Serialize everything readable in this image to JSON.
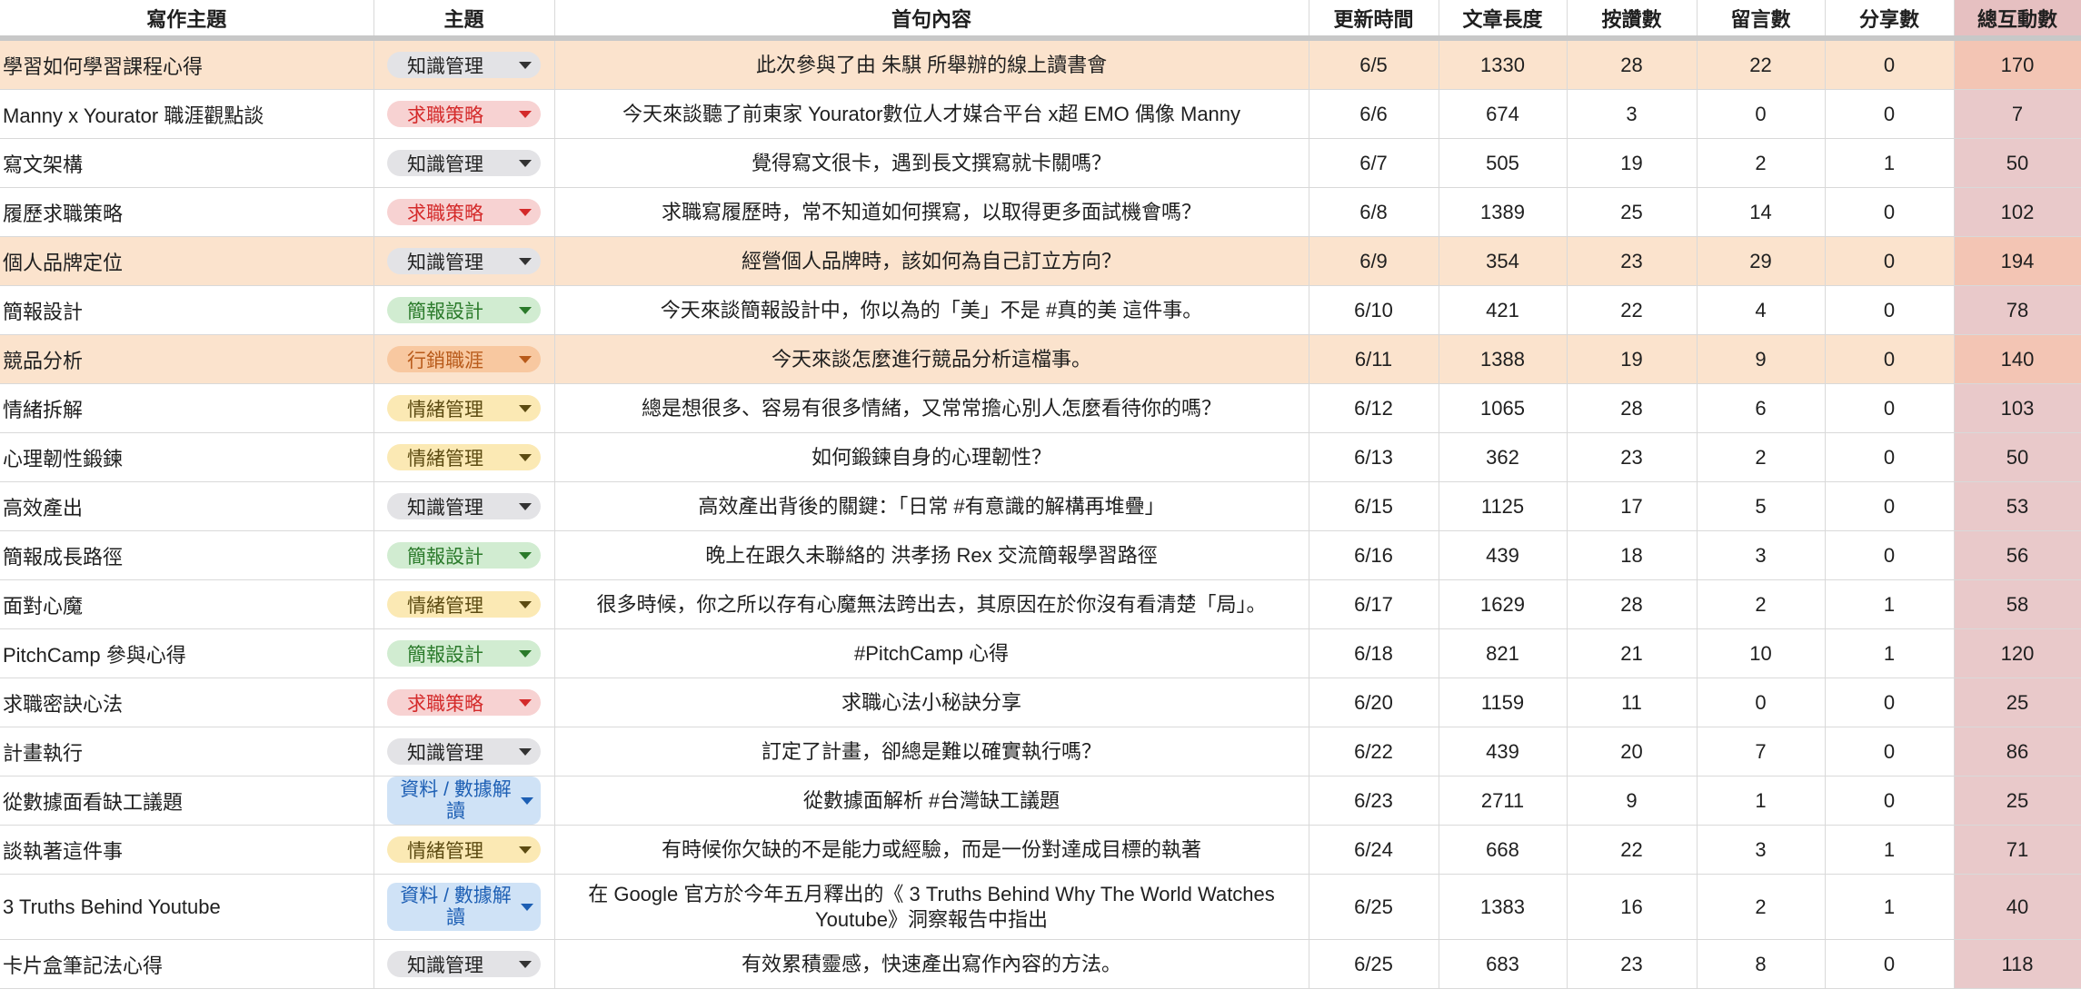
{
  "headers": {
    "topic": "寫作主題",
    "category": "主題",
    "first_sentence": "首句內容",
    "updated": "更新時間",
    "length": "文章長度",
    "likes": "按讚數",
    "comments": "留言數",
    "shares": "分享數",
    "total": "總互動數"
  },
  "colors": {
    "highlight_row": "#fbe3cd",
    "total_column": "#e9c9ca",
    "chip_gray": "#e3e3e6",
    "chip_red": "#f7d2d2",
    "chip_green": "#d1ecd1",
    "chip_yellow": "#fbe9b4",
    "chip_orange": "#f8c8a0",
    "chip_blue": "#cfe2f6"
  },
  "rows": [
    {
      "topic": "學習如何學習課程心得",
      "category": "知識管理",
      "first": "此次參與了由 朱騏 所舉辦的線上讀書會",
      "updated": "6/5",
      "length": "1330",
      "likes": "28",
      "comments": "22",
      "shares": "0",
      "total": "170"
    },
    {
      "topic": "Manny x Yourator 職涯觀點談",
      "category": "求職策略",
      "first": "今天來談聽了前東家 Yourator數位人才媒合平台 x超 EMO 偶像 Manny",
      "updated": "6/6",
      "length": "674",
      "likes": "3",
      "comments": "0",
      "shares": "0",
      "total": "7"
    },
    {
      "topic": "寫文架構",
      "category": "知識管理",
      "first": "覺得寫文很卡，遇到長文撰寫就卡關嗎？",
      "updated": "6/7",
      "length": "505",
      "likes": "19",
      "comments": "2",
      "shares": "1",
      "total": "50"
    },
    {
      "topic": "履歷求職策略",
      "category": "求職策略",
      "first": "求職寫履歷時，常不知道如何撰寫，以取得更多面試機會嗎？",
      "updated": "6/8",
      "length": "1389",
      "likes": "25",
      "comments": "14",
      "shares": "0",
      "total": "102"
    },
    {
      "topic": "個人品牌定位",
      "category": "知識管理",
      "first": "經營個人品牌時，該如何為自己訂立方向？",
      "updated": "6/9",
      "length": "354",
      "likes": "23",
      "comments": "29",
      "shares": "0",
      "total": "194"
    },
    {
      "topic": "簡報設計",
      "category": "簡報設計",
      "first": "今天來談簡報設計中，你以為的「美」不是 #真的美 這件事。",
      "updated": "6/10",
      "length": "421",
      "likes": "22",
      "comments": "4",
      "shares": "0",
      "total": "78"
    },
    {
      "topic": "競品分析",
      "category": "行銷職涯",
      "first": "今天來談怎麼進行競品分析這檔事。",
      "updated": "6/11",
      "length": "1388",
      "likes": "19",
      "comments": "9",
      "shares": "0",
      "total": "140"
    },
    {
      "topic": "情緒拆解",
      "category": "情緒管理",
      "first": "總是想很多、容易有很多情緒，又常常擔心別人怎麼看待你的嗎？",
      "updated": "6/12",
      "length": "1065",
      "likes": "28",
      "comments": "6",
      "shares": "0",
      "total": "103"
    },
    {
      "topic": "心理韌性鍛鍊",
      "category": "情緒管理",
      "first": "如何鍛鍊自身的心理韌性？",
      "updated": "6/13",
      "length": "362",
      "likes": "23",
      "comments": "2",
      "shares": "0",
      "total": "50"
    },
    {
      "topic": "高效產出",
      "category": "知識管理",
      "first": "高效產出背後的關鍵：「日常 #有意識的解構再堆疊」",
      "updated": "6/15",
      "length": "1125",
      "likes": "17",
      "comments": "5",
      "shares": "0",
      "total": "53"
    },
    {
      "topic": "簡報成長路徑",
      "category": "簡報設計",
      "first": "晚上在跟久未聯絡的 洪孝扬 Rex 交流簡報學習路徑",
      "updated": "6/16",
      "length": "439",
      "likes": "18",
      "comments": "3",
      "shares": "0",
      "total": "56"
    },
    {
      "topic": "面對心魔",
      "category": "情緒管理",
      "first": "很多時候，你之所以存有心魔無法跨出去，其原因在於你沒有看清楚「局」。",
      "updated": "6/17",
      "length": "1629",
      "likes": "28",
      "comments": "2",
      "shares": "1",
      "total": "58"
    },
    {
      "topic": "PitchCamp 參與心得",
      "category": "簡報設計",
      "first": "#PitchCamp 心得",
      "updated": "6/18",
      "length": "821",
      "likes": "21",
      "comments": "10",
      "shares": "1",
      "total": "120"
    },
    {
      "topic": "求職密訣心法",
      "category": "求職策略",
      "first": "求職心法小秘訣分享",
      "updated": "6/20",
      "length": "1159",
      "likes": "11",
      "comments": "0",
      "shares": "0",
      "total": "25"
    },
    {
      "topic": "計畫執行",
      "category": "知識管理",
      "first": "訂定了計畫，卻總是難以確實執行嗎？",
      "updated": "6/22",
      "length": "439",
      "likes": "20",
      "comments": "7",
      "shares": "0",
      "total": "86"
    },
    {
      "topic": "從數據面看缺工議題",
      "category": "資料 / 數據解讀",
      "first": "從數據面解析 #台灣缺工議題",
      "updated": "6/23",
      "length": "2711",
      "likes": "9",
      "comments": "1",
      "shares": "0",
      "total": "25"
    },
    {
      "topic": "談執著這件事",
      "category": "情緒管理",
      "first": "有時候你欠缺的不是能力或經驗，而是一份對達成目標的執著",
      "updated": "6/24",
      "length": "668",
      "likes": "22",
      "comments": "3",
      "shares": "1",
      "total": "71"
    },
    {
      "topic": "3 Truths Behind Youtube",
      "category": "資料 / 數據解讀",
      "first": "在 Google 官方於今年五月釋出的《 3 Truths Behind Why The World Watches Youtube》洞察報告中指出",
      "updated": "6/25",
      "length": "1383",
      "likes": "16",
      "comments": "2",
      "shares": "1",
      "total": "40"
    },
    {
      "topic": "卡片盒筆記法心得",
      "category": "知識管理",
      "first": "有效累積靈感，快速產出寫作內容的方法。",
      "updated": "6/25",
      "length": "683",
      "likes": "23",
      "comments": "8",
      "shares": "0",
      "total": "118"
    }
  ]
}
